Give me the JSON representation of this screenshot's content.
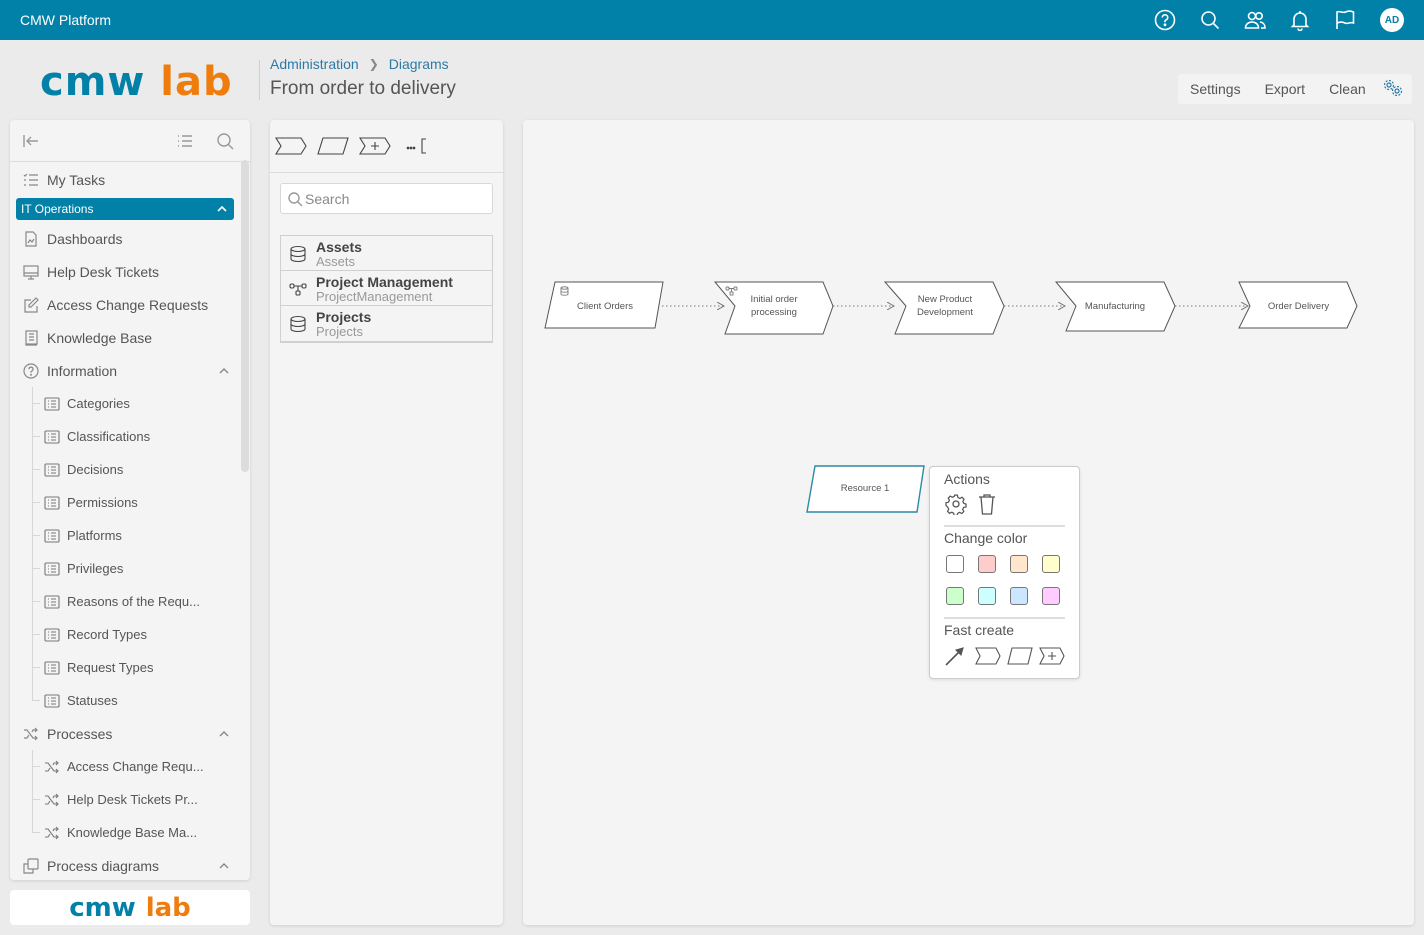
{
  "topbar": {
    "app_title": "CMW Platform",
    "icons": [
      "help-icon",
      "search-icon",
      "users-icon",
      "bell-icon",
      "flag-icon"
    ],
    "avatar_initials": "AD"
  },
  "logo": {
    "part1": "cmw",
    "part2": "lab"
  },
  "breadcrumb": {
    "items": [
      "Administration",
      "Diagrams"
    ]
  },
  "page_title": "From order to delivery",
  "toolbar": {
    "settings": "Settings",
    "export": "Export",
    "clean": "Clean"
  },
  "sidebar": {
    "my_tasks": "My Tasks",
    "group": "IT Operations",
    "items": [
      {
        "label": "Dashboards",
        "icon": "dashboard-icon"
      },
      {
        "label": "Help Desk Tickets",
        "icon": "monitor-icon"
      },
      {
        "label": "Access Change Requests",
        "icon": "edit-icon"
      },
      {
        "label": "Knowledge Base",
        "icon": "book-icon"
      }
    ],
    "information": {
      "label": "Information",
      "children": [
        "Categories",
        "Classifications",
        "Decisions",
        "Permissions",
        "Platforms",
        "Privileges",
        "Reasons of the Requ...",
        "Record Types",
        "Request Types",
        "Statuses"
      ]
    },
    "processes": {
      "label": "Processes",
      "children": [
        "Access Change Requ...",
        "Help Desk Tickets Pr...",
        "Knowledge Base Ma..."
      ]
    },
    "process_diagrams": {
      "label": "Process diagrams"
    }
  },
  "palette": {
    "tools": [
      "process-step-shape",
      "resource-shape",
      "subprocess-shape",
      "annotation-shape"
    ],
    "search_placeholder": "Search",
    "items": [
      {
        "title": "Assets",
        "subtitle": "Assets",
        "icon": "database-icon"
      },
      {
        "title": "Project Management",
        "subtitle": "ProjectManagement",
        "icon": "process-tree-icon"
      },
      {
        "title": "Projects",
        "subtitle": "Projects",
        "icon": "database-icon"
      }
    ]
  },
  "diagram": {
    "nodes": [
      {
        "id": "client-orders",
        "label": "Client Orders",
        "type": "resource",
        "icon": "database-icon"
      },
      {
        "id": "initial-order-processing",
        "label": "Initial order processing",
        "type": "process",
        "icon": "process-tree-icon"
      },
      {
        "id": "new-product-development",
        "label": "New Product Development",
        "type": "process"
      },
      {
        "id": "manufacturing",
        "label": "Manufacturing",
        "type": "process"
      },
      {
        "id": "order-delivery",
        "label": "Order Delivery",
        "type": "process"
      },
      {
        "id": "resource-1",
        "label": "Resource 1",
        "type": "resource",
        "selected": true
      }
    ],
    "edges": [
      [
        "client-orders",
        "initial-order-processing"
      ],
      [
        "initial-order-processing",
        "new-product-development"
      ],
      [
        "new-product-development",
        "manufacturing"
      ],
      [
        "manufacturing",
        "order-delivery"
      ]
    ]
  },
  "popup": {
    "actions_title": "Actions",
    "actions": [
      "settings-icon",
      "trash-icon"
    ],
    "change_color_title": "Change color",
    "colors": [
      "#ffffff",
      "#ffcccc",
      "#ffe6cc",
      "#ffffcc",
      "#ccffcc",
      "#ccffff",
      "#cce6ff",
      "#ffccff"
    ],
    "fast_create_title": "Fast create",
    "fast_create": [
      "connector-arrow",
      "process-step-shape",
      "resource-shape",
      "subprocess-shape"
    ]
  },
  "colors": {
    "brand_blue": "#0281a8",
    "brand_orange": "#ee7d0e",
    "selected_outline": "#2b8aa8"
  }
}
